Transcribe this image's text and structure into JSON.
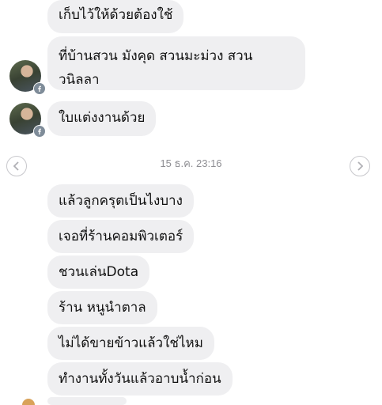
{
  "messages": [
    {
      "text": "เก็บไว้ให้ด้วยต้องใช้"
    },
    {
      "text": "ที่บ้านสวน มังคุด สวนมะม่วง สวน\nวนิลลา"
    },
    {
      "text": "ใบแต่งงานด้วย"
    },
    {
      "text": "แล้วลูกครุตเป็นไงบาง"
    },
    {
      "text": "เจอที่ร้านคอมพิวเตอร์"
    },
    {
      "text": "ชวนเล่นDota"
    },
    {
      "text": "ร้าน หนูนำตาล"
    },
    {
      "text": "ไม่ได้ขายข้าวแล้วใช่ไหม"
    },
    {
      "text": "ทำงานทั้งวันแล้วอาบน้ำก่อน"
    }
  ],
  "timestamp": "15 ธ.ค. 23:16",
  "icons": {
    "prev": "chevron-left-icon",
    "next": "chevron-right-icon",
    "badge": "facebook-icon"
  },
  "colors": {
    "bubble": "#efeff1",
    "badge": "#7f8c99",
    "timestamp": "#8e8e93"
  }
}
